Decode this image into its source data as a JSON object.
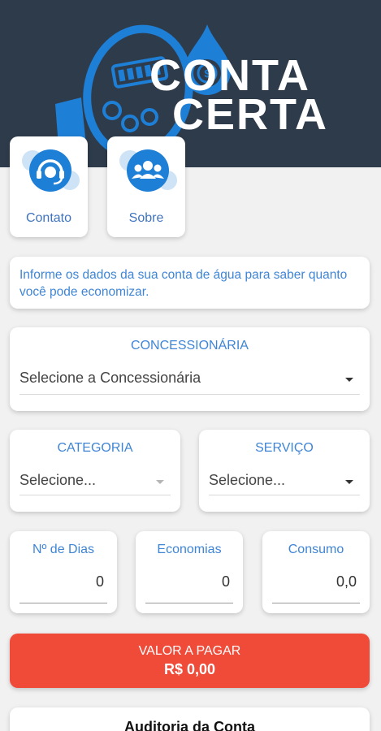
{
  "brand": {
    "line1": "CONTA",
    "line2": "CERTA",
    "header_color": "#2e3b4b",
    "accent_color": "#1e7fd6"
  },
  "shortcuts": [
    {
      "label": "Contato",
      "icon": "headset-icon"
    },
    {
      "label": "Sobre",
      "icon": "users-icon"
    }
  ],
  "info": {
    "text": "Informe os dados da sua conta de água para saber quanto você pode economizar."
  },
  "form": {
    "concessionaria": {
      "title": "CONCESSIONÁRIA",
      "value": "Selecione a Concessionária"
    },
    "categoria": {
      "title": "CATEGORIA",
      "value": "Selecione..."
    },
    "servico": {
      "title": "SERVIÇO",
      "value": "Selecione..."
    },
    "dias": {
      "title": "Nº de Dias",
      "value": "0"
    },
    "economias": {
      "title": "Economias",
      "value": "0"
    },
    "consumo": {
      "title": "Consumo",
      "value": "0,0"
    }
  },
  "payment": {
    "label": "VALOR A PAGAR",
    "value": "R$ 0,00",
    "color": "#f04a38"
  },
  "audit": {
    "title": "Auditoria da Conta"
  }
}
